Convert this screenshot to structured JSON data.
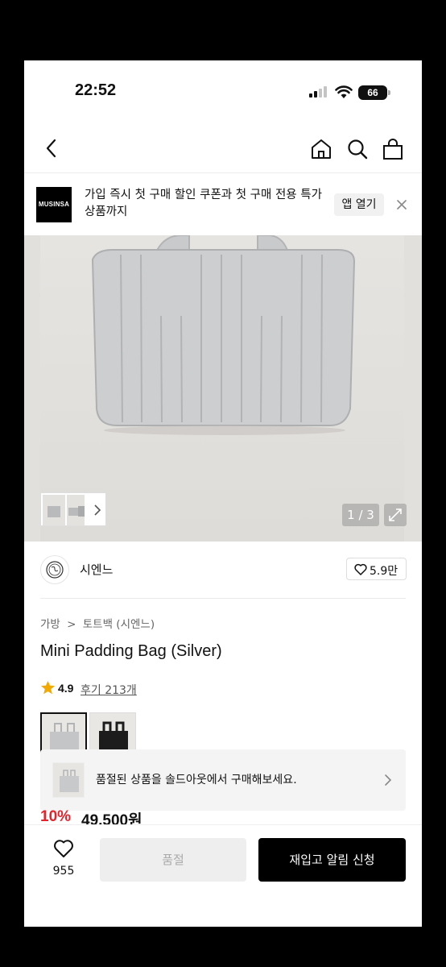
{
  "status_bar": {
    "time": "22:52",
    "battery": "66"
  },
  "nav": {
    "back_icon": "chevron-left-icon",
    "home_icon": "home-icon",
    "search_icon": "search-icon",
    "cart_icon": "shopping-bag-icon"
  },
  "promo": {
    "logo_text": "MUSINSA",
    "message": "가입 즉시 첫 구매 할인 쿠폰과 첫 구매 전용 특가 상품까지",
    "app_open_label": "앱 열기"
  },
  "gallery": {
    "counter": "1 / 3"
  },
  "brand": {
    "name": "시엔느",
    "likes": "5.9만"
  },
  "breadcrumb": {
    "category": "가방",
    "separator": ">",
    "subcategory": "토트백 (시엔느)"
  },
  "product": {
    "title": "Mini Padding Bag (Silver)",
    "rating": "4.9",
    "reviews": "후기 213개",
    "discount": "10%",
    "price": "49,500원"
  },
  "soldout_banner": {
    "text": "품절된 상품을 솔드아웃에서 구매해보세요."
  },
  "bottom_bar": {
    "wish_count": "955",
    "soldout_label": "품절",
    "restock_label": "재입고 알림 신청"
  },
  "colors": {
    "accent_red": "#e8222b",
    "primary_black": "#000000"
  }
}
